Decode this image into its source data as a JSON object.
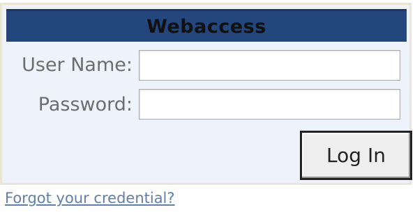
{
  "form": {
    "title": "Webaccess",
    "username_label": "User Name:",
    "username_value": "",
    "password_label": "Password:",
    "password_value": "",
    "login_label": "Log In"
  },
  "links": {
    "forgot_credential": "Forgot your credential?"
  },
  "colors": {
    "header_bg": "#23467d",
    "panel_bg": "#eef2fb",
    "panel_border": "#e9e6d6",
    "label_text": "#6d6d6d",
    "link_text": "#5f7fad"
  }
}
